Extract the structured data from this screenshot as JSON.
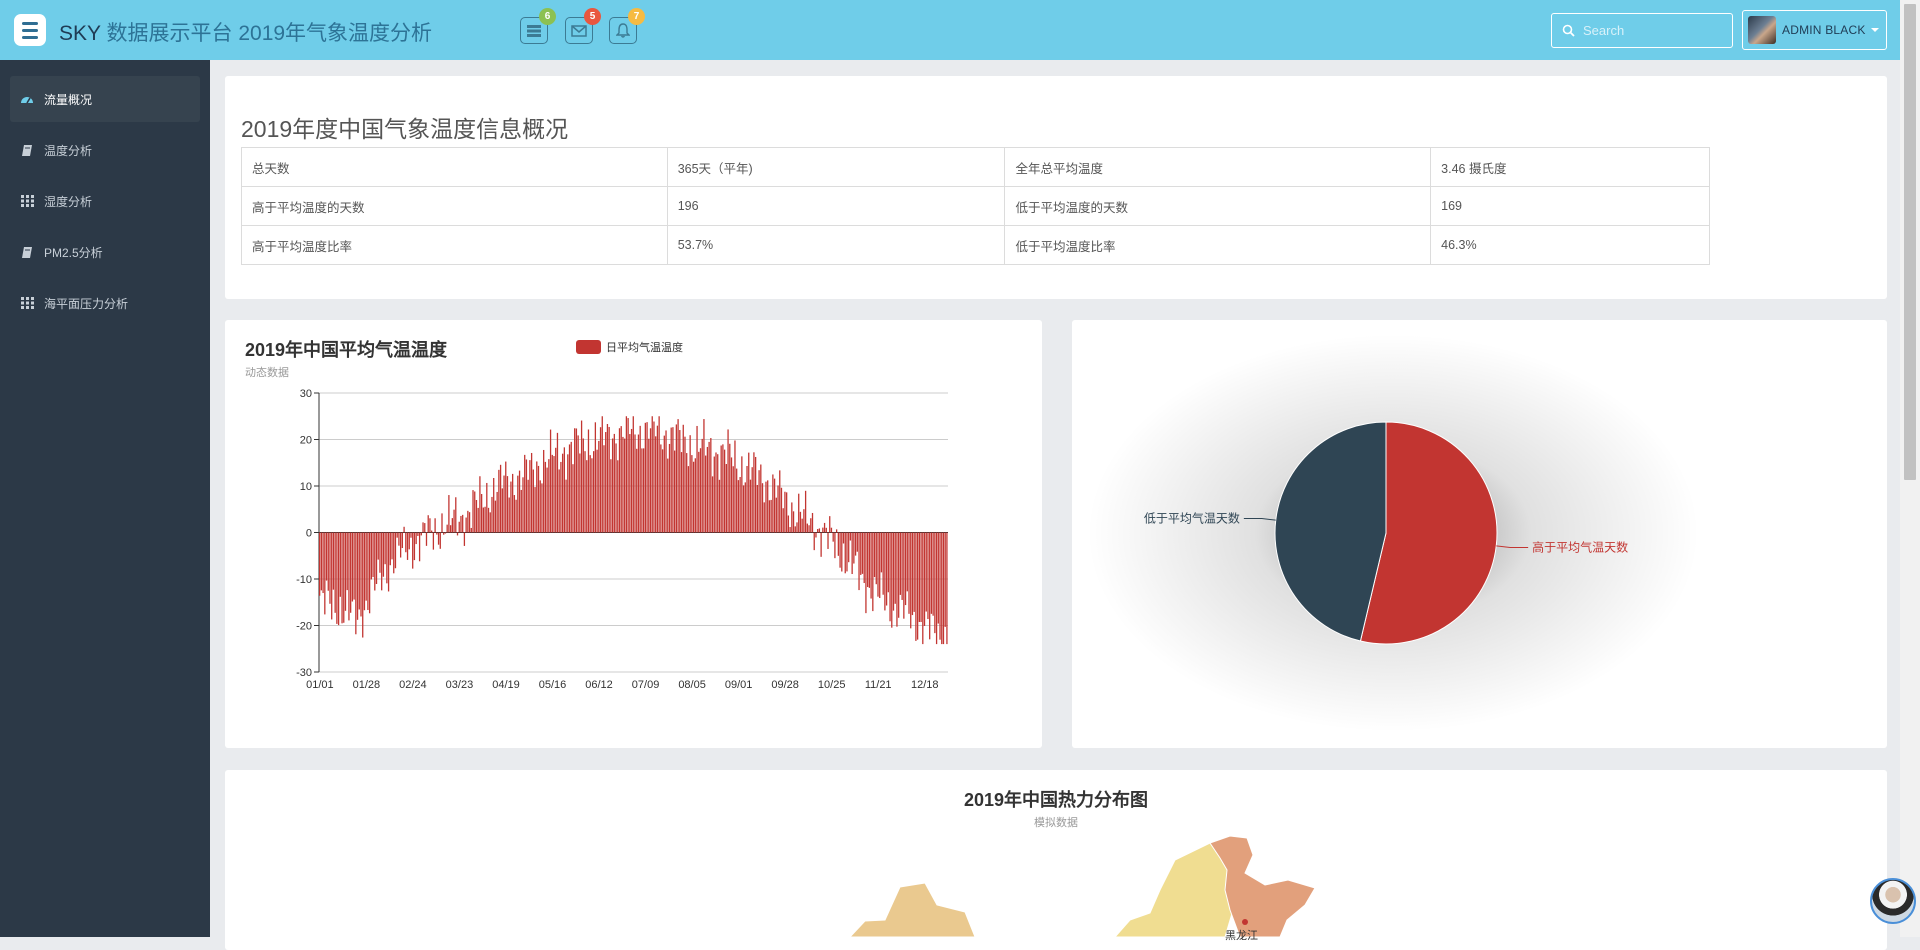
{
  "header": {
    "brand": "SKY",
    "title": "数据展示平台 2019年气象温度分析",
    "badges": [
      {
        "icon": "tasks-icon",
        "count": "6",
        "color": "#8cc152"
      },
      {
        "icon": "envelope-icon",
        "count": "5",
        "color": "#e9573f"
      },
      {
        "icon": "bell-icon",
        "count": "7",
        "color": "#f6bb42"
      }
    ],
    "search_placeholder": "Search",
    "user_name": "ADMIN BLACK"
  },
  "sidebar": {
    "items": [
      {
        "label": "流量概况",
        "icon": "dashboard-icon",
        "active": true
      },
      {
        "label": "温度分析",
        "icon": "book-icon"
      },
      {
        "label": "湿度分析",
        "icon": "grid-icon"
      },
      {
        "label": "PM2.5分析",
        "icon": "book-icon"
      },
      {
        "label": "海平面压力分析",
        "icon": "grid-icon"
      }
    ]
  },
  "overview": {
    "title": "2019年度中国气象温度信息概况",
    "rows": [
      [
        "总天数",
        "365天（平年)",
        "全年总平均温度",
        "3.46 摄氏度"
      ],
      [
        "高于平均温度的天数",
        "196",
        "低于平均温度的天数",
        "169"
      ],
      [
        "高于平均温度比率",
        "53.7%",
        "低于平均温度比率",
        "46.3%"
      ]
    ]
  },
  "chart_data": [
    {
      "type": "bar",
      "title": "2019年中国平均气温温度",
      "subtitle": "动态数据",
      "legend": "日平均气温温度",
      "color": "#c23531",
      "ylim": [
        -30,
        30
      ],
      "yticks": [
        30,
        20,
        10,
        0,
        -10,
        -20,
        -30
      ],
      "xticks": [
        "01/01",
        "01/28",
        "02/24",
        "03/23",
        "04/19",
        "05/16",
        "06/12",
        "07/09",
        "08/05",
        "09/01",
        "09/28",
        "10/25",
        "11/21",
        "12/18"
      ],
      "monthly_anchor_values": [
        -15,
        -16,
        -19,
        -12,
        -6,
        -3,
        0,
        2,
        4,
        8,
        11,
        12,
        15,
        17,
        19,
        20,
        21,
        22,
        22,
        21,
        19,
        18,
        17,
        14,
        12,
        8,
        4,
        1,
        -3,
        -8,
        -13,
        -16,
        -18,
        -21,
        -23
      ],
      "days": 365
    },
    {
      "type": "pie",
      "slices": [
        {
          "name": "高于平均气温天数",
          "value": 196,
          "color": "#c23531"
        },
        {
          "name": "低于平均气温天数",
          "value": 169,
          "color": "#2f4554"
        }
      ]
    }
  ],
  "heatmap": {
    "title": "2019年中国热力分布图",
    "subtitle": "模拟数据",
    "map_label": "黑龙江"
  }
}
